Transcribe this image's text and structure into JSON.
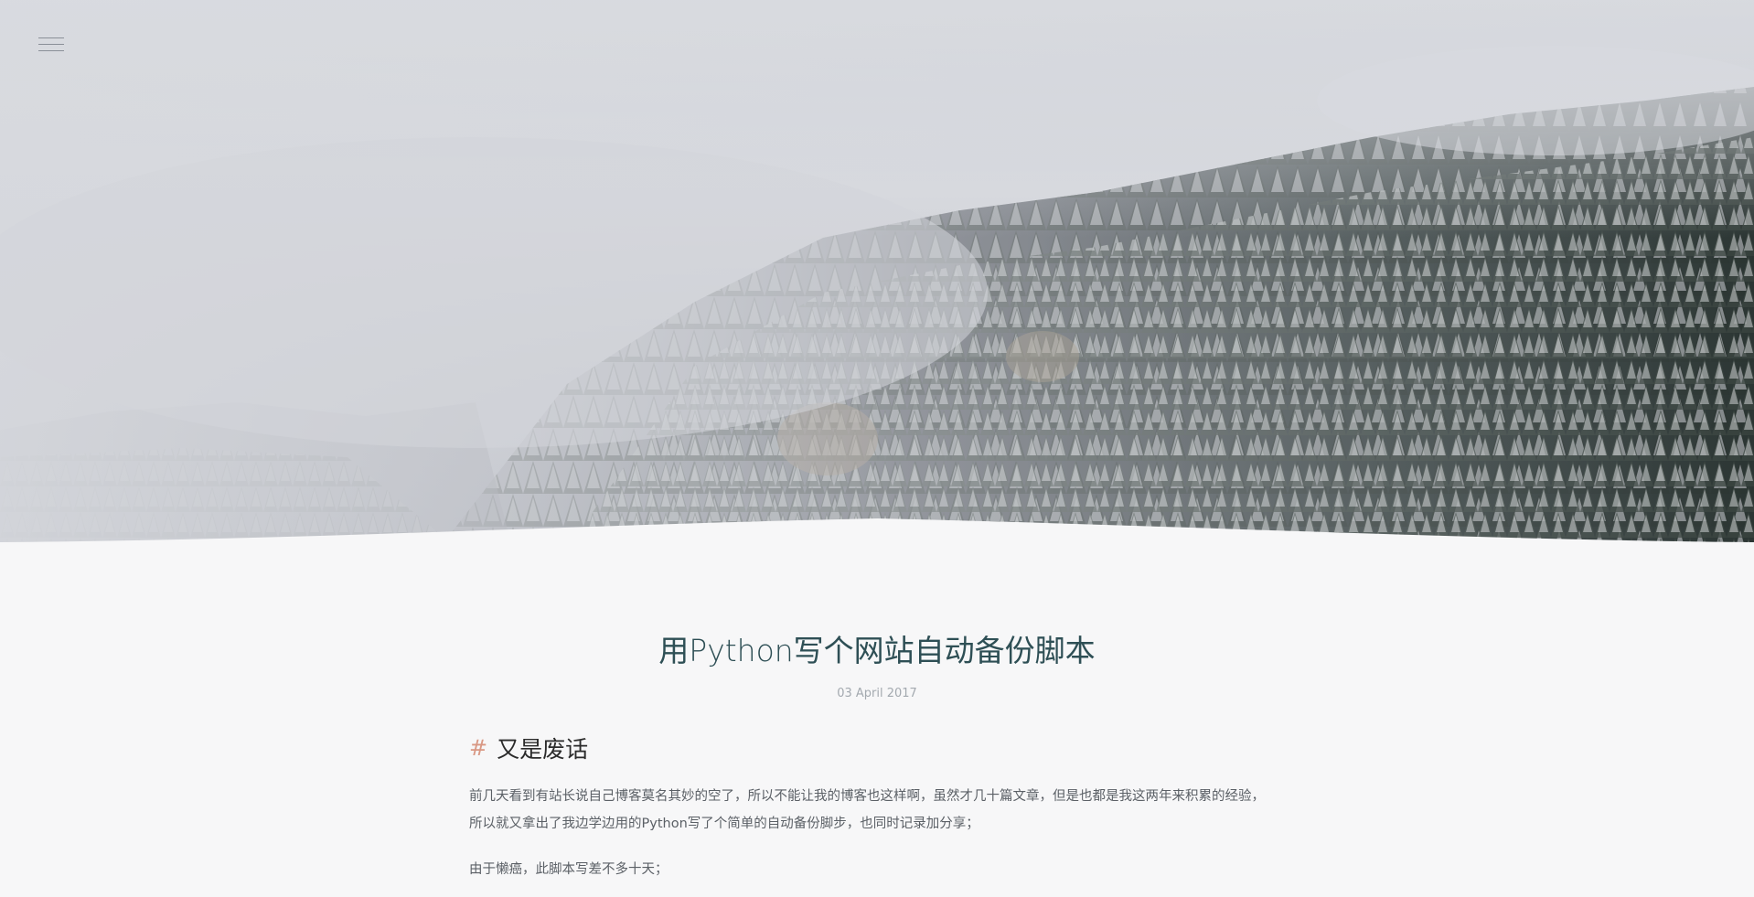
{
  "header": {
    "menu_icon": "hamburger-menu-icon",
    "hero_image_description": "foggy snowy forest"
  },
  "post": {
    "title": "用Python写个网站自动备份脚本",
    "date": "03 April 2017",
    "section": {
      "marker": "#",
      "heading": "又是废话"
    },
    "paragraphs": [
      "前几天看到有站长说自己博客莫名其妙的空了，所以不能让我的博客也这样啊，虽然才几十篇文章，但是也都是我这两年来积累的经验，",
      "所以就又拿出了我边学边用的Python写了个简单的自动备份脚步，也同时记录加分享；",
      "由于懒癌，此脚本写差不多十天；"
    ]
  },
  "colors": {
    "title": "#2e4f55",
    "accent_hash": "#d99884",
    "body_text": "#5b6066",
    "background": "#f7f7f8"
  }
}
